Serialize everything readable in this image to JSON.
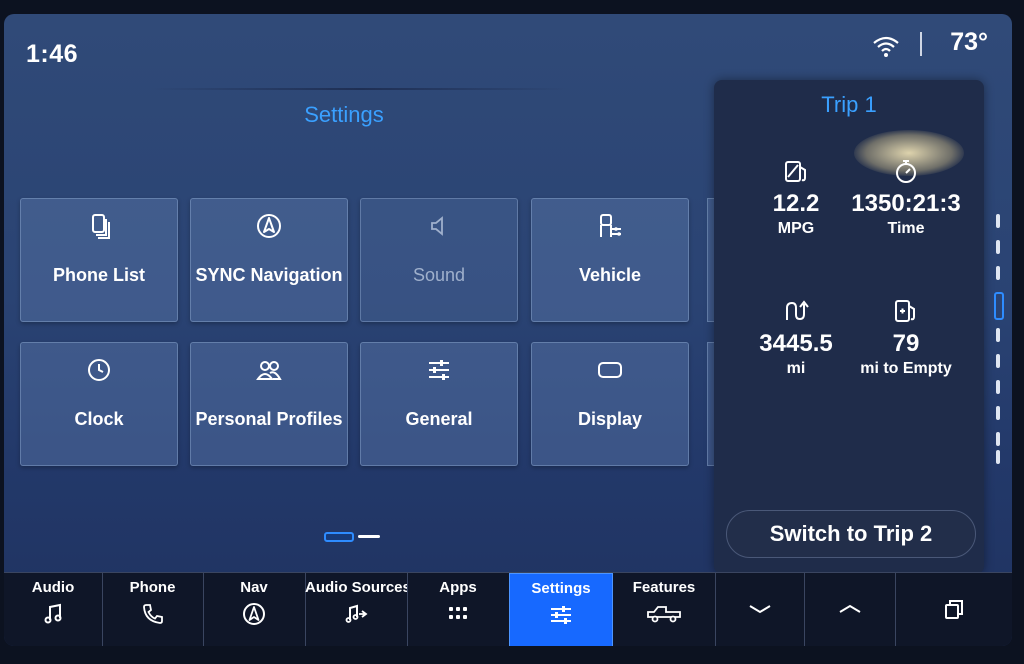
{
  "status": {
    "time": "1:46",
    "temperature": "73°"
  },
  "settings": {
    "title": "Settings",
    "tiles": [
      {
        "label": "Phone List",
        "icon": "phone-list-icon"
      },
      {
        "label": "SYNC Navigation",
        "icon": "navigation-icon"
      },
      {
        "label": "Sound",
        "icon": "speaker-icon"
      },
      {
        "label": "Vehicle",
        "icon": "vehicle-icon"
      },
      {
        "label": "Clock",
        "icon": "clock-icon"
      },
      {
        "label": "Personal Profiles",
        "icon": "profiles-icon"
      },
      {
        "label": "General",
        "icon": "sliders-icon"
      },
      {
        "label": "Display",
        "icon": "display-icon"
      }
    ]
  },
  "trip": {
    "title": "Trip 1",
    "stats": [
      {
        "value": "12.2",
        "unit": "MPG",
        "icon": "fuel-economy-icon"
      },
      {
        "value": "1350:21:3",
        "unit": "Time",
        "icon": "stopwatch-icon"
      },
      {
        "value": "3445.5",
        "unit": "mi",
        "icon": "distance-icon"
      },
      {
        "value": "79",
        "unit": "mi to Empty",
        "icon": "fuel-pump-icon"
      }
    ],
    "switch_label": "Switch to Trip 2"
  },
  "nav": {
    "items": [
      {
        "label": "Audio",
        "icon": "music-note-icon"
      },
      {
        "label": "Phone",
        "icon": "phone-icon"
      },
      {
        "label": "Nav",
        "icon": "navigation-icon"
      },
      {
        "label": "Audio Sources",
        "icon": "audio-sources-icon"
      },
      {
        "label": "Apps",
        "icon": "apps-grid-icon"
      },
      {
        "label": "Settings",
        "icon": "sliders-icon"
      },
      {
        "label": "Features",
        "icon": "truck-icon"
      },
      {
        "label": "",
        "icon": "chevron-down-icon"
      },
      {
        "label": "",
        "icon": "chevron-up-icon"
      },
      {
        "label": "",
        "icon": "windows-icon"
      }
    ],
    "active_color": "#1769ff"
  }
}
